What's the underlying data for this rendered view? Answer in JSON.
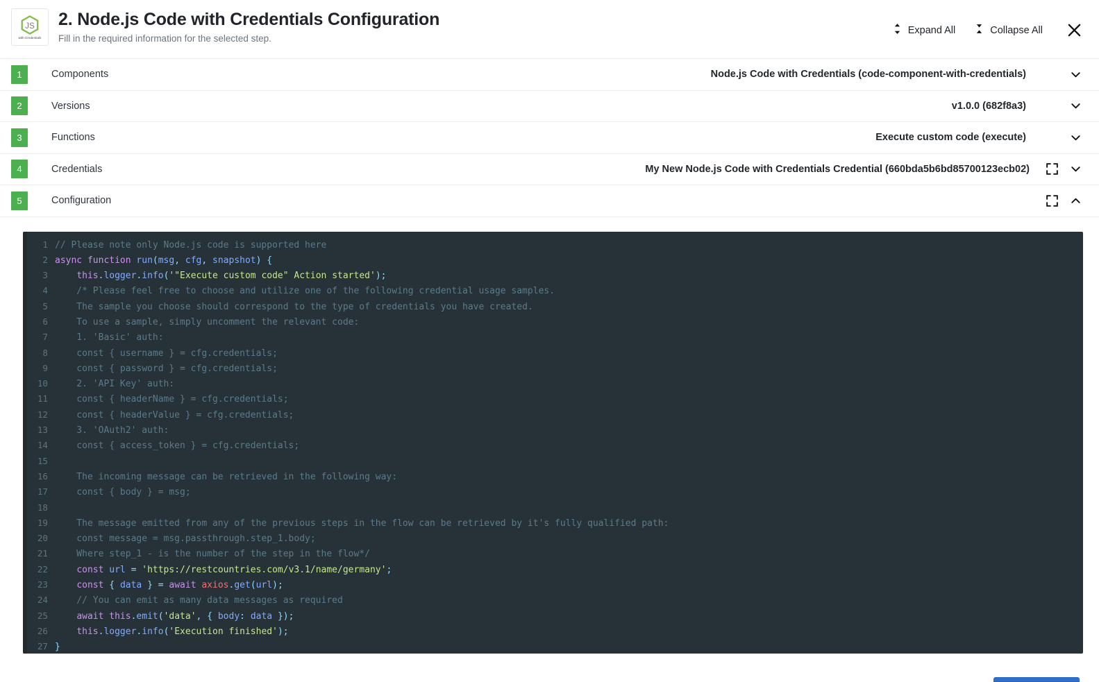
{
  "header": {
    "title": "2. Node.js Code with Credentials Configuration",
    "subtitle": "Fill in the required information for the selected step.",
    "logo_caption": "with Credentials",
    "logo_mark": "JS",
    "expand_all_label": "Expand All",
    "collapse_all_label": "Collapse All",
    "close_label": "×"
  },
  "accordion": {
    "rows": [
      {
        "number": "1",
        "label": "Components",
        "value": "Node.js Code with Credentials (code-component-with-credentials)",
        "has_fullscreen": false,
        "chevron": "down"
      },
      {
        "number": "2",
        "label": "Versions",
        "value": "v1.0.0 (682f8a3)",
        "has_fullscreen": false,
        "chevron": "down"
      },
      {
        "number": "3",
        "label": "Functions",
        "value": "Execute custom code (execute)",
        "has_fullscreen": false,
        "chevron": "down"
      },
      {
        "number": "4",
        "label": "Credentials",
        "value": "My New Node.js Code with Credentials Credential (660bda5b6bd85700123ecb02)",
        "has_fullscreen": true,
        "chevron": "down"
      },
      {
        "number": "5",
        "label": "Configuration",
        "value": "",
        "has_fullscreen": true,
        "chevron": "up"
      }
    ]
  },
  "editor": {
    "language": "javascript",
    "lines": [
      {
        "n": "1",
        "tokens": [
          {
            "c": "com",
            "t": "// Please note only Node.js code is supported here"
          }
        ]
      },
      {
        "n": "2",
        "tokens": [
          {
            "c": "kw",
            "t": "async"
          },
          {
            "c": "plain",
            "t": " "
          },
          {
            "c": "kw",
            "t": "function"
          },
          {
            "c": "plain",
            "t": " "
          },
          {
            "c": "fn",
            "t": "run"
          },
          {
            "c": "punc",
            "t": "("
          },
          {
            "c": "var",
            "t": "msg"
          },
          {
            "c": "punc",
            "t": ","
          },
          {
            "c": "plain",
            "t": " "
          },
          {
            "c": "var",
            "t": "cfg"
          },
          {
            "c": "punc",
            "t": ","
          },
          {
            "c": "plain",
            "t": " "
          },
          {
            "c": "var",
            "t": "snapshot"
          },
          {
            "c": "punc",
            "t": ")"
          },
          {
            "c": "plain",
            "t": " "
          },
          {
            "c": "punc",
            "t": "{"
          }
        ]
      },
      {
        "n": "3",
        "tokens": [
          {
            "c": "plain",
            "t": "    "
          },
          {
            "c": "kw",
            "t": "this"
          },
          {
            "c": "punc",
            "t": "."
          },
          {
            "c": "fn",
            "t": "logger"
          },
          {
            "c": "punc",
            "t": "."
          },
          {
            "c": "fn",
            "t": "info"
          },
          {
            "c": "punc",
            "t": "("
          },
          {
            "c": "str",
            "t": "'\"Execute custom code\" Action started'"
          },
          {
            "c": "punc",
            "t": ");"
          }
        ]
      },
      {
        "n": "4",
        "tokens": [
          {
            "c": "com",
            "t": "    /* Please feel free to choose and utilize one of the following credential usage samples."
          }
        ]
      },
      {
        "n": "5",
        "tokens": [
          {
            "c": "com",
            "t": "    The sample you choose should correspond to the type of credentials you have created."
          }
        ]
      },
      {
        "n": "6",
        "tokens": [
          {
            "c": "com",
            "t": "    To use a sample, simply uncomment the relevant code:"
          }
        ]
      },
      {
        "n": "7",
        "tokens": [
          {
            "c": "com",
            "t": "    1. 'Basic' auth:"
          }
        ]
      },
      {
        "n": "8",
        "tokens": [
          {
            "c": "com",
            "t": "    const { username } = cfg.credentials;"
          }
        ]
      },
      {
        "n": "9",
        "tokens": [
          {
            "c": "com",
            "t": "    const { password } = cfg.credentials;"
          }
        ]
      },
      {
        "n": "10",
        "tokens": [
          {
            "c": "com",
            "t": "    2. 'API Key' auth:"
          }
        ]
      },
      {
        "n": "11",
        "tokens": [
          {
            "c": "com",
            "t": "    const { headerName } = cfg.credentials;"
          }
        ]
      },
      {
        "n": "12",
        "tokens": [
          {
            "c": "com",
            "t": "    const { headerValue } = cfg.credentials;"
          }
        ]
      },
      {
        "n": "13",
        "tokens": [
          {
            "c": "com",
            "t": "    3. 'OAuth2' auth:"
          }
        ]
      },
      {
        "n": "14",
        "tokens": [
          {
            "c": "com",
            "t": "    const { access_token } = cfg.credentials;"
          }
        ]
      },
      {
        "n": "15",
        "tokens": [
          {
            "c": "com",
            "t": ""
          }
        ]
      },
      {
        "n": "16",
        "tokens": [
          {
            "c": "com",
            "t": "    The incoming message can be retrieved in the following way:"
          }
        ]
      },
      {
        "n": "17",
        "tokens": [
          {
            "c": "com",
            "t": "    const { body } = msg;"
          }
        ]
      },
      {
        "n": "18",
        "tokens": [
          {
            "c": "com",
            "t": ""
          }
        ]
      },
      {
        "n": "19",
        "tokens": [
          {
            "c": "com",
            "t": "    The message emitted from any of the previous steps in the flow can be retrieved by it's fully qualified path:"
          }
        ]
      },
      {
        "n": "20",
        "tokens": [
          {
            "c": "com",
            "t": "    const message = msg.passthrough.step_1.body;"
          }
        ]
      },
      {
        "n": "21",
        "tokens": [
          {
            "c": "com",
            "t": "    Where step_1 - is the number of the step in the flow*/"
          }
        ]
      },
      {
        "n": "22",
        "tokens": [
          {
            "c": "plain",
            "t": "    "
          },
          {
            "c": "kw",
            "t": "const"
          },
          {
            "c": "plain",
            "t": " "
          },
          {
            "c": "var",
            "t": "url"
          },
          {
            "c": "plain",
            "t": " "
          },
          {
            "c": "punc",
            "t": "="
          },
          {
            "c": "plain",
            "t": " "
          },
          {
            "c": "str",
            "t": "'https://restcountries.com/v3.1/name/germany'"
          },
          {
            "c": "punc",
            "t": ";"
          }
        ]
      },
      {
        "n": "23",
        "tokens": [
          {
            "c": "plain",
            "t": "    "
          },
          {
            "c": "kw",
            "t": "const"
          },
          {
            "c": "plain",
            "t": " "
          },
          {
            "c": "punc",
            "t": "{"
          },
          {
            "c": "plain",
            "t": " "
          },
          {
            "c": "var",
            "t": "data"
          },
          {
            "c": "plain",
            "t": " "
          },
          {
            "c": "punc",
            "t": "}"
          },
          {
            "c": "plain",
            "t": " "
          },
          {
            "c": "punc",
            "t": "="
          },
          {
            "c": "plain",
            "t": " "
          },
          {
            "c": "kw",
            "t": "await"
          },
          {
            "c": "plain",
            "t": " "
          },
          {
            "c": "cls",
            "t": "axios"
          },
          {
            "c": "punc",
            "t": "."
          },
          {
            "c": "fn",
            "t": "get"
          },
          {
            "c": "punc",
            "t": "("
          },
          {
            "c": "var",
            "t": "url"
          },
          {
            "c": "punc",
            "t": ");"
          }
        ]
      },
      {
        "n": "24",
        "tokens": [
          {
            "c": "com",
            "t": "    // You can emit as many data messages as required"
          }
        ]
      },
      {
        "n": "25",
        "tokens": [
          {
            "c": "plain",
            "t": "    "
          },
          {
            "c": "kw",
            "t": "await"
          },
          {
            "c": "plain",
            "t": " "
          },
          {
            "c": "kw",
            "t": "this"
          },
          {
            "c": "punc",
            "t": "."
          },
          {
            "c": "fn",
            "t": "emit"
          },
          {
            "c": "punc",
            "t": "("
          },
          {
            "c": "str",
            "t": "'data'"
          },
          {
            "c": "punc",
            "t": ","
          },
          {
            "c": "plain",
            "t": " "
          },
          {
            "c": "punc",
            "t": "{"
          },
          {
            "c": "plain",
            "t": " "
          },
          {
            "c": "var",
            "t": "body"
          },
          {
            "c": "punc",
            "t": ":"
          },
          {
            "c": "plain",
            "t": " "
          },
          {
            "c": "var",
            "t": "data"
          },
          {
            "c": "plain",
            "t": " "
          },
          {
            "c": "punc",
            "t": "});"
          }
        ]
      },
      {
        "n": "26",
        "tokens": [
          {
            "c": "plain",
            "t": "    "
          },
          {
            "c": "kw",
            "t": "this"
          },
          {
            "c": "punc",
            "t": "."
          },
          {
            "c": "fn",
            "t": "logger"
          },
          {
            "c": "punc",
            "t": "."
          },
          {
            "c": "fn",
            "t": "info"
          },
          {
            "c": "punc",
            "t": "("
          },
          {
            "c": "str",
            "t": "'Execution finished'"
          },
          {
            "c": "punc",
            "t": ");"
          }
        ]
      },
      {
        "n": "27",
        "tokens": [
          {
            "c": "punc",
            "t": "}"
          }
        ]
      }
    ]
  },
  "footer": {
    "primary_button_label": ""
  },
  "colors": {
    "step_badge_green": "#4caf50",
    "editor_background": "#273238",
    "primary_button_blue": "#2f6fd0",
    "keyword_purple": "#c792ea",
    "string_green": "#c3e88d",
    "function_blue": "#82aaff",
    "comment_gray": "#5a7b8a",
    "punctuation_cyan": "#89ddff",
    "class_salmon": "#f07178"
  }
}
